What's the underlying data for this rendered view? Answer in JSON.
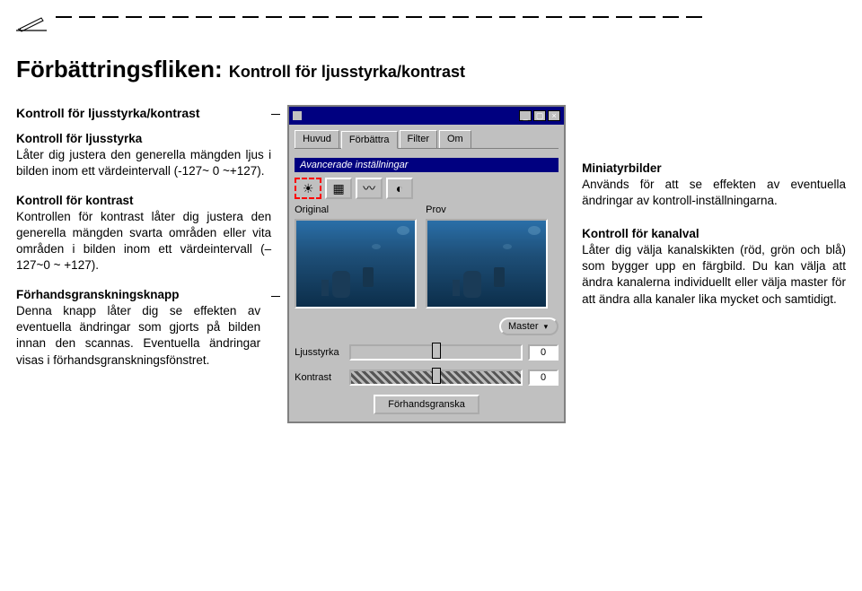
{
  "dash_count": 28,
  "title_main": "Förbättringsfliken:",
  "title_sub": "Kontroll för ljusstyrka/kontrast",
  "left": {
    "h1": "Kontroll för ljusstyrka/kontrast",
    "h2": "Kontroll för ljusstyrka",
    "p2": "Låter dig justera den generella mängden ljus i bilden inom ett värdeintervall (-127~ 0 ~+127).",
    "h3": "Kontroll för kontrast",
    "p3": "Kontrollen för kontrast låter dig justera den generella mängden svarta områden eller vita områden i bilden inom ett värdeintervall (–127~0 ~ +127).",
    "h4": "Förhandsgranskningsknapp",
    "p4a": "Denna knapp låter dig se effekten av eventuella ändringar som gjorts på bilden innan den scannas.",
    "p4b": "Eventuella ändringar visas i förhandsgranskningsfönstret."
  },
  "panel": {
    "tabs": [
      "Huvud",
      "Förbättra",
      "Filter",
      "Om"
    ],
    "active_tab": 1,
    "header": "Avancerade inställningar",
    "tool_icons": [
      "brightness-icon",
      "levels-icon",
      "curves-icon",
      "balance-icon"
    ],
    "labels": {
      "original": "Original",
      "prov": "Prov"
    },
    "master": "Master",
    "sliders": {
      "ljusstyrka": {
        "label": "Ljusstyrka",
        "value": "0"
      },
      "kontrast": {
        "label": "Kontrast",
        "value": "0"
      }
    },
    "preview": "Förhandsgranska"
  },
  "right": {
    "h1": "Miniatyrbilder",
    "p1": "Används för att se effekten av eventuella ändringar av kontroll-inställningarna.",
    "h2": "Kontroll för kanalval",
    "p2": "Låter dig välja kanalskikten (röd, grön och blå) som bygger upp en färgbild. Du kan välja att ändra kanalerna individuellt eller välja master för att ändra alla kanaler lika mycket och samtidigt."
  }
}
